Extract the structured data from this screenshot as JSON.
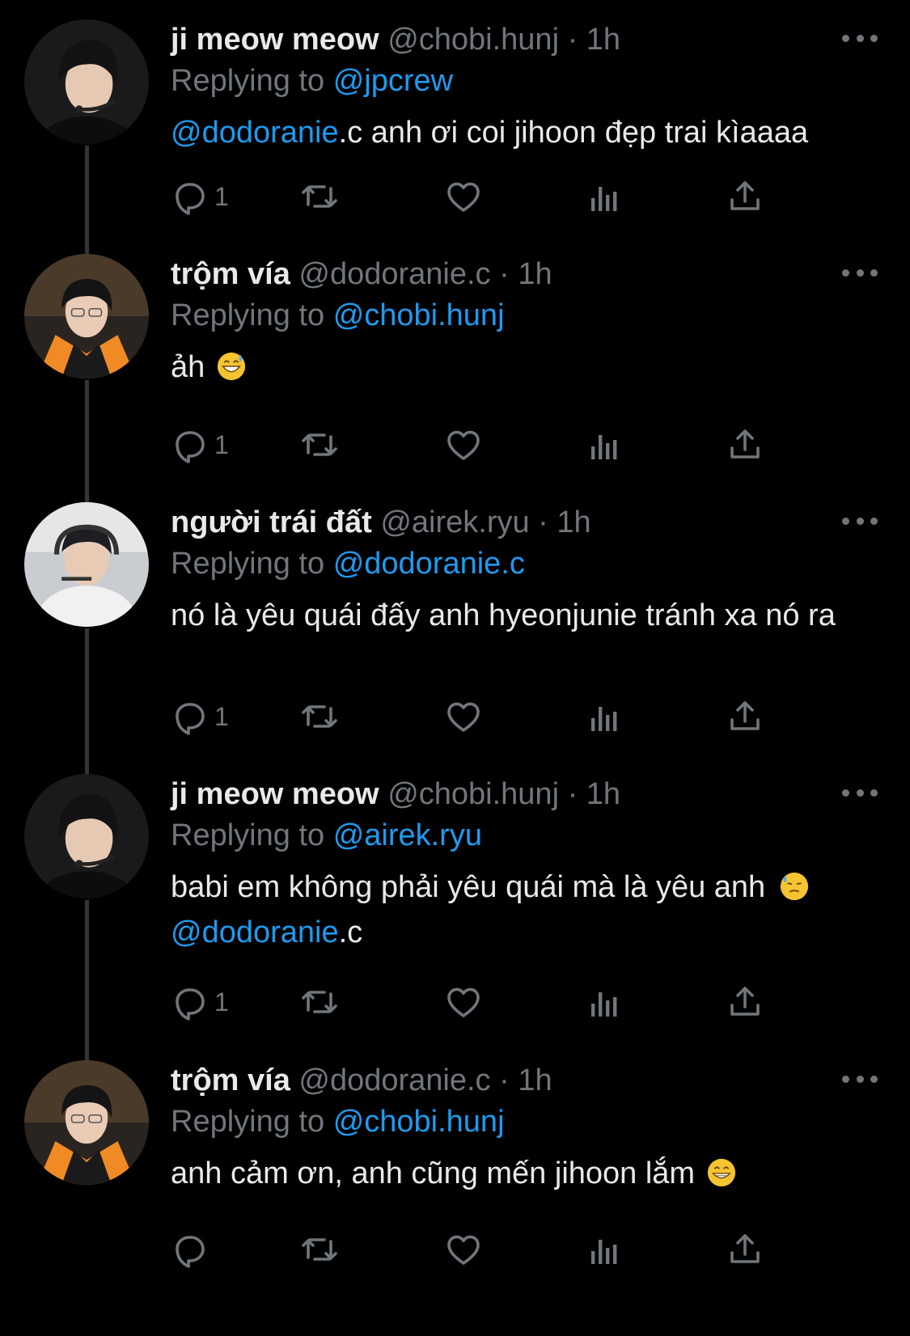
{
  "tweets": [
    {
      "name": "ji meow meow",
      "handle": "@chobi.hunj",
      "time": "1h",
      "reply_label": "Replying to",
      "reply_to": "@jpcrew",
      "body": [
        {
          "t": "@dodoranie",
          "link": true
        },
        {
          "t": ".c  anh ơi coi jihoon đẹp trai kìaaaa",
          "link": false
        }
      ],
      "emoji": "",
      "reply_count": "1",
      "avatar_style": "headset"
    },
    {
      "name": "trộm vía",
      "handle": "@dodoranie.c",
      "time": "1h",
      "reply_label": "Replying to",
      "reply_to": "@chobi.hunj",
      "body": [
        {
          "t": "ảh",
          "link": false
        }
      ],
      "emoji": "grinning-sweat",
      "reply_count": "1",
      "avatar_style": "orange-jersey"
    },
    {
      "name": "người trái đất",
      "handle": "@airek.ryu",
      "time": "1h",
      "reply_label": "Replying to",
      "reply_to": "@dodoranie.c",
      "body": [
        {
          "t": "nó là yêu quái đấy anh hyeonjunie tránh xa nó ra",
          "link": false
        }
      ],
      "emoji": "",
      "reply_count": "1",
      "avatar_style": "light-room"
    },
    {
      "name": "ji meow meow",
      "handle": "@chobi.hunj",
      "time": "1h",
      "reply_label": "Replying to",
      "reply_to": "@airek.ryu",
      "body": [
        {
          "t": "babi em không phải yêu quái mà là yêu anh ",
          "link": false
        },
        {
          "t": "__EMOJI__",
          "link": false
        },
        {
          "t": " ",
          "link": false
        },
        {
          "t": "@dodoranie",
          "link": true
        },
        {
          "t": ".c",
          "link": false
        }
      ],
      "emoji": "downcast-sweat",
      "reply_count": "1",
      "avatar_style": "headset"
    },
    {
      "name": "trộm vía",
      "handle": "@dodoranie.c",
      "time": "1h",
      "reply_label": "Replying to",
      "reply_to": "@chobi.hunj",
      "body": [
        {
          "t": "anh cảm ơn, anh cũng mến jihoon lắm",
          "link": false
        }
      ],
      "emoji": "beaming",
      "reply_count": "",
      "avatar_style": "orange-jersey"
    }
  ],
  "action_icons": [
    "reply-icon",
    "retweet-icon",
    "like-icon",
    "views-icon",
    "share-icon"
  ],
  "colors": {
    "background": "#000000",
    "text": "#e7e9ea",
    "muted": "#71767b",
    "link": "#1d9bf0",
    "thread_line": "#333639"
  }
}
